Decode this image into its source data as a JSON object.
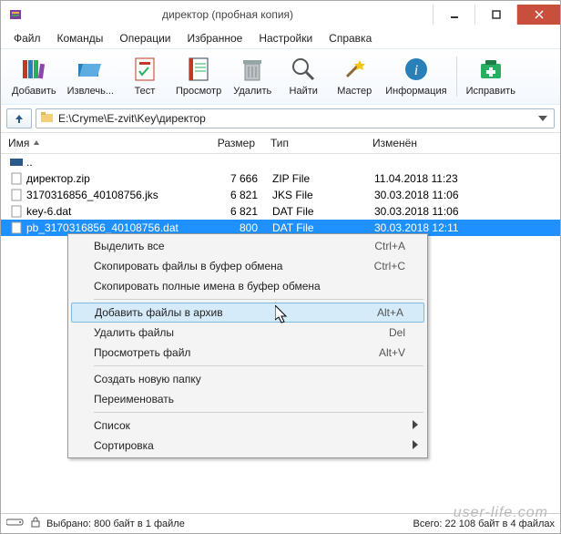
{
  "title": "директор (пробная копия)",
  "menu": [
    "Файл",
    "Команды",
    "Операции",
    "Избранное",
    "Настройки",
    "Справка"
  ],
  "toolbar": [
    "Добавить",
    "Извлечь...",
    "Тест",
    "Просмотр",
    "Удалить",
    "Найти",
    "Мастер",
    "Информация",
    "Исправить"
  ],
  "path": "E:\\Cryme\\E-zvit\\Key\\директор",
  "columns": {
    "name": "Имя",
    "size": "Размер",
    "type": "Тип",
    "mod": "Изменён"
  },
  "rows": [
    {
      "name": "..",
      "size": "",
      "type": "",
      "mod": "",
      "icon": "up"
    },
    {
      "name": "директор.zip",
      "size": "7 666",
      "type": "ZIP File",
      "mod": "11.04.2018 11:23",
      "icon": "file"
    },
    {
      "name": "3170316856_40108756.jks",
      "size": "6 821",
      "type": "JKS File",
      "mod": "30.03.2018 11:06",
      "icon": "file"
    },
    {
      "name": "key-6.dat",
      "size": "6 821",
      "type": "DAT File",
      "mod": "30.03.2018 11:06",
      "icon": "file"
    },
    {
      "name": "pb_3170316856_40108756.dat",
      "size": "800",
      "type": "DAT File",
      "mod": "30.03.2018 12:11",
      "icon": "file",
      "selected": true
    }
  ],
  "context": [
    {
      "type": "item",
      "label": "Выделить все",
      "shortcut": "Ctrl+A"
    },
    {
      "type": "item",
      "label": "Скопировать файлы в буфер обмена",
      "shortcut": "Ctrl+C"
    },
    {
      "type": "item",
      "label": "Скопировать полные имена в буфер обмена",
      "shortcut": ""
    },
    {
      "type": "sep"
    },
    {
      "type": "item",
      "label": "Добавить файлы в архив",
      "shortcut": "Alt+A",
      "highlight": true
    },
    {
      "type": "item",
      "label": "Удалить файлы",
      "shortcut": "Del"
    },
    {
      "type": "item",
      "label": "Просмотреть файл",
      "shortcut": "Alt+V"
    },
    {
      "type": "sep"
    },
    {
      "type": "item",
      "label": "Создать новую папку",
      "shortcut": ""
    },
    {
      "type": "item",
      "label": "Переименовать",
      "shortcut": ""
    },
    {
      "type": "sep"
    },
    {
      "type": "item",
      "label": "Список",
      "shortcut": "",
      "submenu": true
    },
    {
      "type": "item",
      "label": "Сортировка",
      "shortcut": "",
      "submenu": true
    }
  ],
  "status": {
    "left": "Выбрано: 800 байт в 1 файле",
    "right": "Всего: 22 108 байт в 4 файлах"
  },
  "watermark": "user-life.com"
}
